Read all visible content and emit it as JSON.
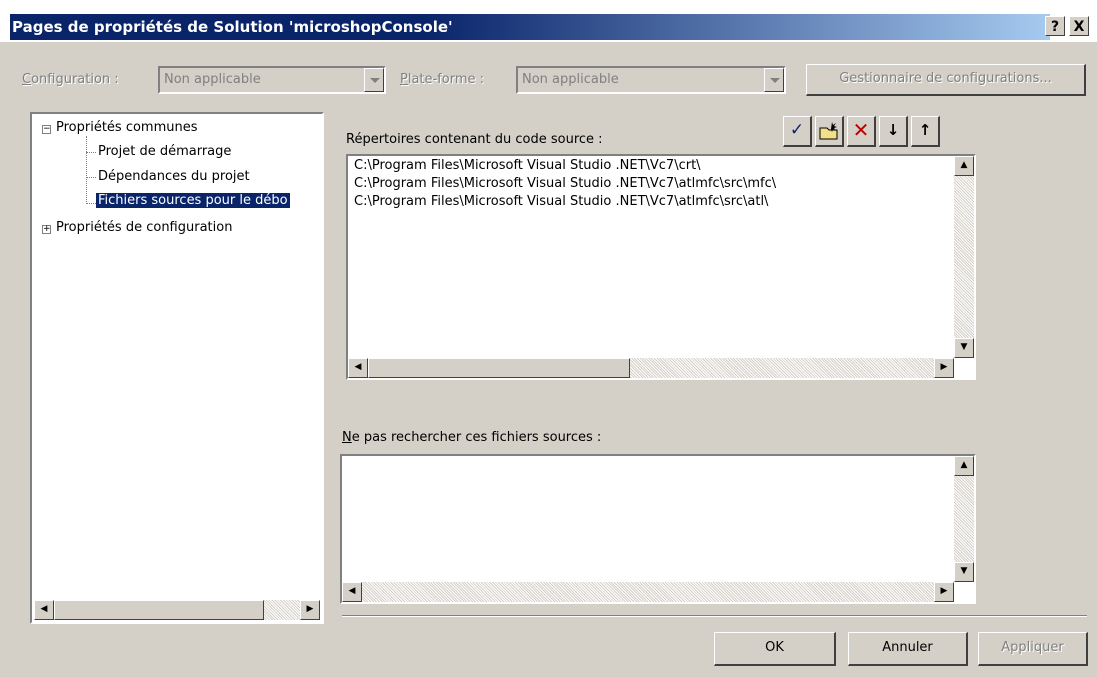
{
  "window": {
    "title": "Pages de propriétés de Solution 'microshopConsole'",
    "help_btn": "?",
    "close_btn": "X"
  },
  "top": {
    "config_label": "Configuration :",
    "config_value": "Non applicable",
    "platform_label": "Plate-forme :",
    "platform_value": "Non applicable",
    "manager_btn": "Gestionnaire de configurations..."
  },
  "tree": {
    "root1": "Propriétés communes",
    "child1": "Projet de démarrage",
    "child2": "Dépendances du projet",
    "child3": "Fichiers sources pour le débo",
    "root2": "Propriétés de configuration"
  },
  "source_dirs": {
    "label": "Répertoires contenant du code source :",
    "lines": [
      "C:\\Program Files\\Microsoft Visual Studio .NET\\Vc7\\crt\\",
      "C:\\Program Files\\Microsoft Visual Studio .NET\\Vc7\\atlmfc\\src\\mfc\\",
      "C:\\Program Files\\Microsoft Visual Studio .NET\\Vc7\\atlmfc\\src\\atl\\"
    ]
  },
  "toolbar": {
    "check_icon": "check-icon",
    "new_folder_icon": "new-folder-icon",
    "delete_icon": "delete-icon",
    "move_down_icon": "move-down-icon",
    "move_up_icon": "move-up-icon"
  },
  "exclude": {
    "label": "Ne pas rechercher ces fichiers sources :"
  },
  "buttons": {
    "ok": "OK",
    "cancel": "Annuler",
    "apply": "Appliquer"
  },
  "colors": {
    "title_bar": "#0a246a",
    "face": "#d4d0c8",
    "selection": "#0a246a",
    "delete_red": "#c00000",
    "check_blue": "#0a246a"
  }
}
